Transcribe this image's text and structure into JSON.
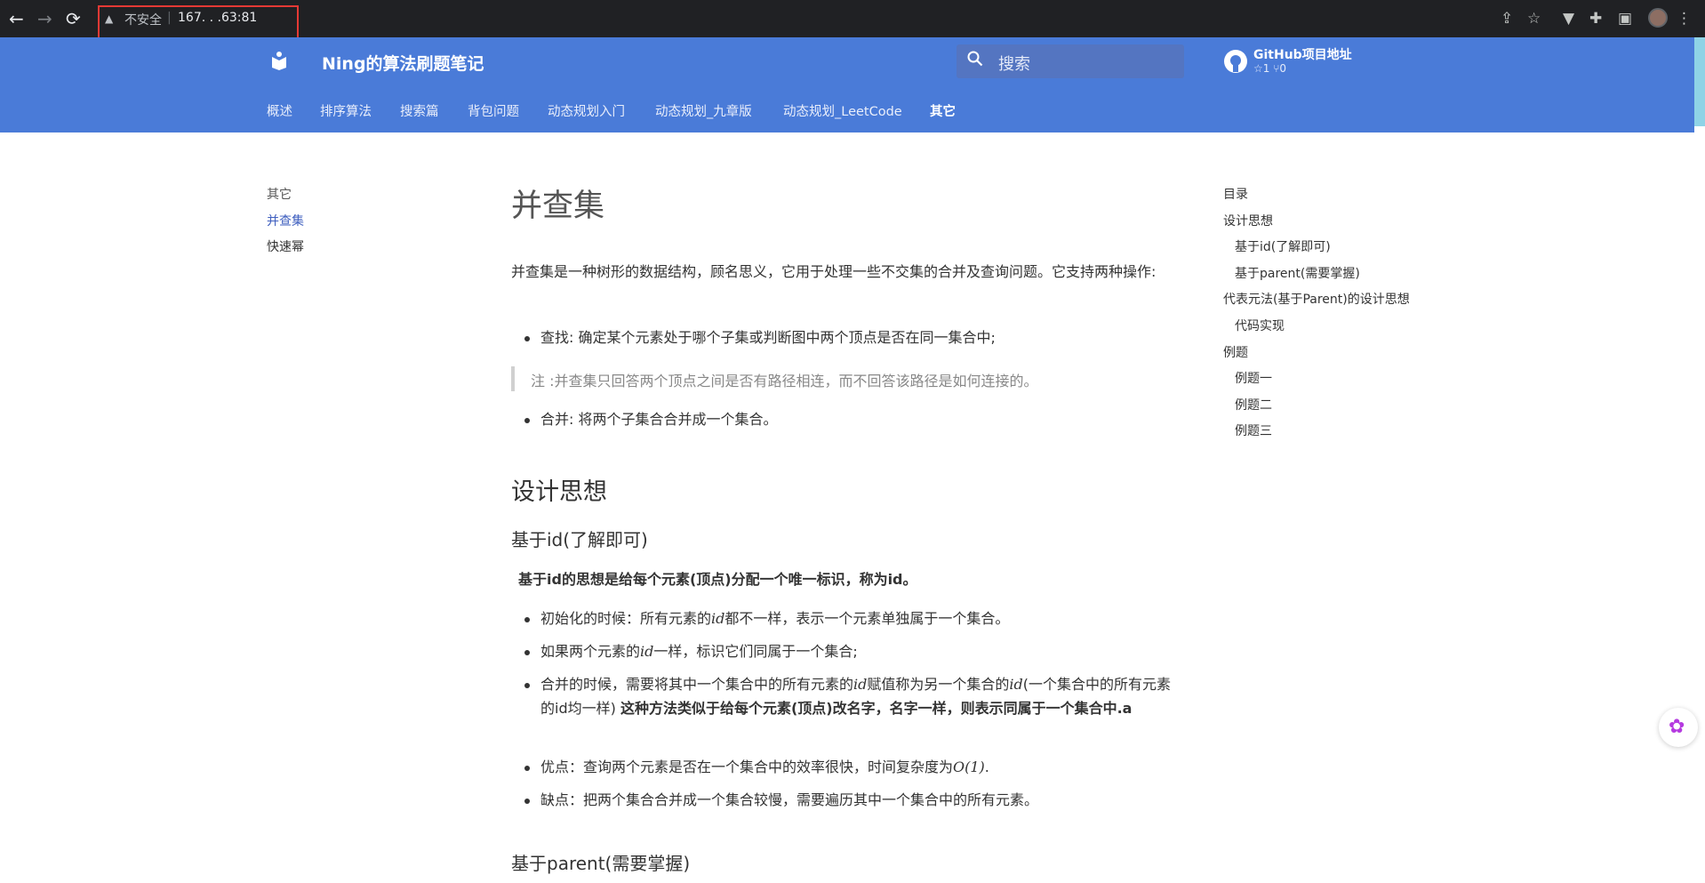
{
  "browser": {
    "back_icon": "←",
    "forward_icon": "→",
    "reload_icon": "⟳",
    "warning_icon": "▲",
    "insecure_label": "不安全",
    "separator": "|",
    "url": "167.  .  .63:81"
  },
  "header": {
    "brand": "Ning的算法刷题笔记",
    "search_placeholder": "搜索",
    "github_title": "GitHub项目地址",
    "github_stats": "☆1  ⑂0",
    "nav": [
      "概述",
      "排序算法",
      "搜索篇",
      "背包问题",
      "动态规划入门",
      "动态规划_九章版",
      "动态规划_LeetCode",
      "其它"
    ]
  },
  "leftnav": {
    "section": "其它",
    "items": [
      "并查集",
      "快速幂"
    ]
  },
  "toc": {
    "title": "目录",
    "items": [
      "设计思想",
      "基于id(了解即可)",
      "基于parent(需要掌握)",
      "代表元法(基于Parent)的设计思想",
      "代码实现",
      "例题",
      "例题一",
      "例题二",
      "例题三"
    ]
  },
  "article": {
    "title": "并查集",
    "intro": "并查集是一种树形的数据结构，顾名思义，它用于处理一些不交集的合并及查询问题。它支持两种操作:",
    "op_find": "查找: 确定某个元素处于哪个子集或判断图中两个顶点是否在同一集合中;",
    "note": "注 :并查集只回答两个顶点之间是否有路径相连，而不回答该路径是如何连接的。",
    "op_union": "合并: 将两个子集合合并成一个集合。",
    "h_design": "设计思想",
    "h_id": "基于id(了解即可)",
    "id_bold": "基于id的思想是给每个元素(顶点)分配一个唯一标识，称为id。",
    "id_li1_a": "初始化的时候：所有元素的",
    "id_li1_m": "id",
    "id_li1_b": "都不一样，表示一个元素单独属于一个集合。",
    "id_li2_a": "如果两个元素的",
    "id_li2_m": "id",
    "id_li2_b": "一样，标识它们同属于一个集合;",
    "id_li3_a": "合并的时候，需要将其中一个集合中的所有元素的",
    "id_li3_m1": "id",
    "id_li3_b": "赋值称为另一个集合的",
    "id_li3_m2": "id",
    "id_li3_c": "(一个集合中的所有元素的id均一样)",
    "id_li3_bold": "这种方法类似于给每个元素(顶点)改名字，名字一样，则表示同属于一个集合中.a",
    "id_li4_a": "优点：查询两个元素是否在一个集合中的效率很快，时间复杂度为",
    "id_li4_m": "O(1)",
    "id_li4_b": ".",
    "id_li5": "缺点：把两个集合合并成一个集合较慢，需要遍历其中一个集合中的所有元素。",
    "h_parent": "基于parent(需要掌握)"
  }
}
